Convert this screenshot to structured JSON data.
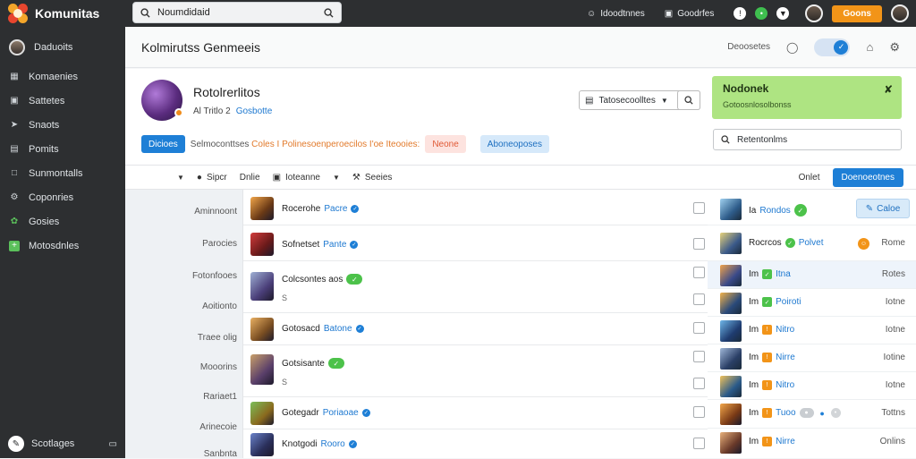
{
  "app": {
    "title": "Komunitas"
  },
  "search": {
    "value": "Noumdidaid"
  },
  "topbar": {
    "links": [
      "Idoodtnnes",
      "Goodrfes"
    ],
    "cta_label": "Goons"
  },
  "sidebar": {
    "profile_label": "Daduoits",
    "items": [
      {
        "label": "Komaenies",
        "icon": "grid-icon"
      },
      {
        "label": "Sattetes",
        "icon": "box-icon"
      },
      {
        "label": "Snaots",
        "icon": "bolt-icon"
      },
      {
        "label": "Pomits",
        "icon": "list-icon"
      },
      {
        "label": "Sunmontalls",
        "icon": "doc-icon"
      },
      {
        "label": "Coponries",
        "icon": "gear-icon"
      },
      {
        "label": "Gosies",
        "icon": "puzzle-icon"
      },
      {
        "label": "Motosdnles",
        "icon": "plus-icon"
      }
    ],
    "bottom_label": "Scotlages"
  },
  "page": {
    "title": "Kolmirutss Genmeeis",
    "header_link": "Deoosetes"
  },
  "group": {
    "name": "Rotolrerlitos",
    "meta_count": "Al Tritlo 2",
    "meta_link": "Gosbotte",
    "ctrl_value": "Tatosecoolltes"
  },
  "notice": {
    "title": "Nodonek",
    "subtitle": "Gotoosnlosolbonss"
  },
  "chips": {
    "primary": "Dicioes",
    "text_plain": "Selmoconttses",
    "text_orange": "Coles I Polinesoenperoecilos I'oe Iteooies:",
    "warn": "Neone",
    "info": "Aboneoposes"
  },
  "filter": {
    "value": "Retentonlms"
  },
  "toolbar": {
    "items": [
      "Sipcr",
      "Dnlie",
      "Ioteanne",
      "Seeies"
    ],
    "right_label": "Onlet",
    "right_button": "Doenoeotnes"
  },
  "left_labels": [
    "Aminnoont",
    "Parocies",
    "Fotonfooes",
    "Aoitionto",
    "Traee olig",
    "Mooorins",
    "Rariaet1",
    "Arinecoie",
    "Sanbnta"
  ],
  "members": [
    {
      "name": "Rocerohe",
      "role": "Pacre",
      "badge": "verified",
      "sub": ""
    },
    {
      "name": "Sofnetset",
      "role": "Pante",
      "badge": "verified",
      "sub": ""
    },
    {
      "name": "Colcsontes aos",
      "role": "",
      "badge": "ok",
      "sub": "S"
    },
    {
      "name": "Gotosacd",
      "role": "Batone",
      "badge": "verified",
      "sub": ""
    },
    {
      "name": "Gotsisante",
      "role": "",
      "badge": "ok",
      "sub": "S"
    },
    {
      "name": "Gotegadr",
      "role": "Poriaoae",
      "badge": "verified",
      "sub": ""
    },
    {
      "name": "Knotgodi",
      "role": "Rooro",
      "badge": "verified",
      "sub": ""
    }
  ],
  "right_rows": [
    {
      "label": "Ia",
      "tag": "Rondos",
      "status": "",
      "button": "Caloe"
    },
    {
      "label": "Rocrcos",
      "tag": "Polvet",
      "status": "Rome"
    },
    {
      "label": "Im",
      "tag": "Itna",
      "status": "Rotes"
    },
    {
      "label": "Im",
      "tag": "Poiroti",
      "status": "Iotne"
    },
    {
      "label": "Im",
      "tag": "Nitro",
      "status": "Iotne"
    },
    {
      "label": "Im",
      "tag": "Nirre",
      "status": "Iotine"
    },
    {
      "label": "Im",
      "tag": "Nitro",
      "status": "Iotne"
    },
    {
      "label": "Im",
      "tag": "Tuoo",
      "status": "Tottns"
    },
    {
      "label": "Im",
      "tag": "Nirre",
      "status": "Onlins"
    }
  ],
  "colors": {
    "accent": "#1e7fd6",
    "cta": "#f29418",
    "notice_bg": "#aee482",
    "sidebar_bg": "#2d2f31"
  }
}
